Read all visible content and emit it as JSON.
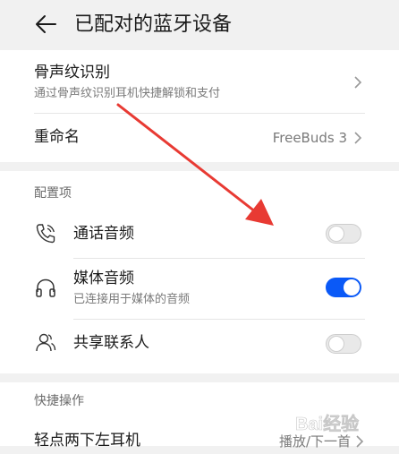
{
  "header": {
    "title": "已配对的蓝牙设备",
    "back_icon": "arrow-left-icon"
  },
  "top_card": {
    "bone_voice": {
      "title": "骨声纹识别",
      "subtitle": "通过骨声纹识别耳机快捷解锁和支付",
      "chevron": "chevron-right-icon"
    },
    "rename": {
      "title": "重命名",
      "value": "FreeBuds 3",
      "chevron": "chevron-right-icon"
    }
  },
  "config": {
    "header": "配置项",
    "items": [
      {
        "title": "通话音频",
        "subtitle": "",
        "icon": "phone-icon",
        "enabled": false
      },
      {
        "title": "媒体音频",
        "subtitle": "已连接用于媒体的音频",
        "icon": "headphones-icon",
        "enabled": true
      },
      {
        "title": "共享联系人",
        "subtitle": "",
        "icon": "contacts-icon",
        "enabled": false
      }
    ]
  },
  "shortcuts": {
    "header": "快捷操作",
    "items": [
      {
        "title": "轻点两下左耳机",
        "value": "播放/下一首",
        "chevron": "chevron-right-icon"
      }
    ]
  },
  "colors": {
    "accent": "#0a59f7",
    "annotation_arrow": "#e83a33",
    "background": "#f1f1f1"
  },
  "watermark": {
    "text": "Bai经验"
  }
}
